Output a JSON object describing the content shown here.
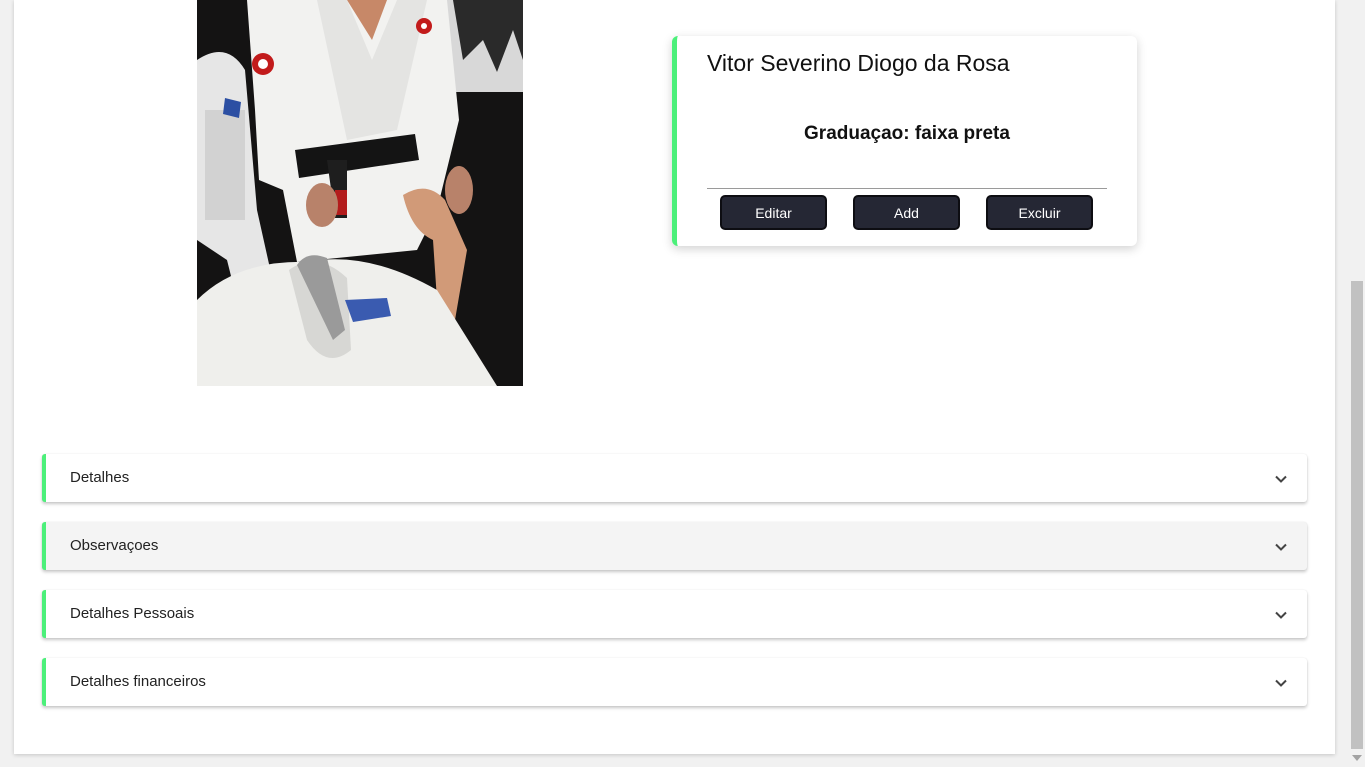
{
  "profile": {
    "name": "Vitor Severino Diogo da Rosa",
    "graduation": "Graduaçao: faixa preta"
  },
  "actions": {
    "edit_label": "Editar",
    "add_label": "Add",
    "delete_label": "Excluir"
  },
  "sections": [
    {
      "label": "Detalhes",
      "icon": "chevron-down-icon"
    },
    {
      "label": "Observaçoes",
      "icon": "chevron-down-icon"
    },
    {
      "label": "Detalhes Pessoais",
      "icon": "chevron-down-icon"
    },
    {
      "label": "Detalhes financeiros",
      "icon": "chevron-down-icon"
    }
  ],
  "colors": {
    "accent": "#4cf07a",
    "button_bg": "#252734"
  }
}
